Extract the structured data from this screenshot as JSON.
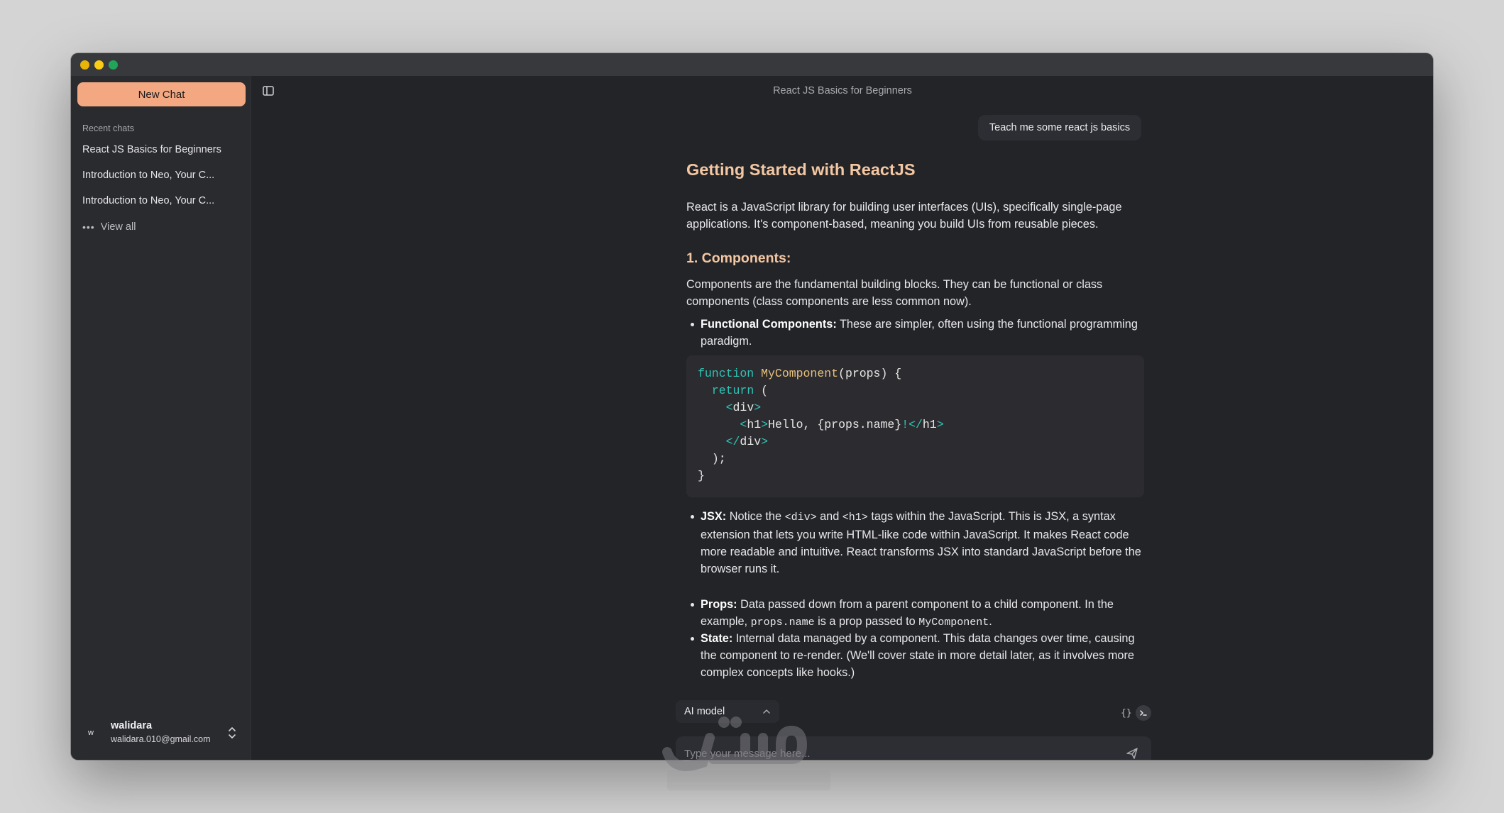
{
  "window": {
    "traffic_lights": [
      "close",
      "minimize",
      "zoom"
    ]
  },
  "sidebar": {
    "new_chat_label": "New Chat",
    "recent_label": "Recent chats",
    "chats": [
      "React JS Basics for Beginners",
      "Introduction to Neo, Your C...",
      "Introduction to Neo, Your C..."
    ],
    "view_all_label": "View all",
    "user": {
      "initial": "w",
      "name": "walidara",
      "email": "walidara.010@gmail.com"
    }
  },
  "header": {
    "title": "React JS Basics for Beginners"
  },
  "conversation": {
    "user_message": "Teach me some react js basics",
    "response": {
      "heading": "Getting Started with ReactJS",
      "intro": "React is a JavaScript library for building user interfaces (UIs), specifically single-page applications. It's component-based, meaning you build UIs from reusable pieces.",
      "section_heading": "1. Components:",
      "section_text": "Components are the fundamental building blocks. They can be functional or class components (class components are less common now).",
      "bullet_functional_title": "Functional Components:",
      "bullet_functional_text": " These are simpler, often using the functional programming paradigm.",
      "code": {
        "kw_function": "function",
        "fn_name": "MyComponent",
        "l1_rest": "(props) {",
        "kw_return": "return",
        "l2_rest": " (",
        "l3_open": "<",
        "l3_tag": "div",
        "l3_close": ">",
        "l4_open": "<",
        "l4_tag": "h1",
        "l4_gt": ">",
        "l4_text": "Hello, {props.name}",
        "l4_excl": "!",
        "l4_endopen": "</",
        "l4_endtag": "h1",
        "l4_endgt": ">",
        "l5_open": "</",
        "l5_tag": "div",
        "l5_close": ">",
        "l6": ");",
        "l7": "}"
      },
      "bullet_jsx_title": "JSX:",
      "bullet_jsx_pre": " Notice the ",
      "bullet_jsx_div": "<div>",
      "bullet_jsx_and": " and ",
      "bullet_jsx_h1": "<h1>",
      "bullet_jsx_post": " tags within the JavaScript. This is JSX, a syntax extension that lets you write HTML-like code within JavaScript. It makes React code more readable and intuitive. React transforms JSX into standard JavaScript before the browser runs it.",
      "bullet_props_title": "Props:",
      "bullet_props_pre": " Data passed down from a parent component to a child component. In the example, ",
      "bullet_props_code1": "props.name",
      "bullet_props_mid": " is a prop passed to ",
      "bullet_props_code2": "MyComponent",
      "bullet_props_end": ".",
      "bullet_state_title": "State:",
      "bullet_state_text": " Internal data managed by a component. This data changes over time, causing the component to re-render. (We'll cover state in more detail later, as it involves more complex concepts like hooks.)"
    }
  },
  "composer": {
    "model_label": "AI model",
    "braces_glyph": "{}",
    "placeholder": "Type your message here..."
  },
  "colors": {
    "accent": "#f4a882",
    "heading": "#f4c7a3",
    "background": "#232428",
    "sidebar": "#2a2b2f",
    "code_keyword": "#2ec4b6",
    "code_function": "#e5c07b"
  }
}
